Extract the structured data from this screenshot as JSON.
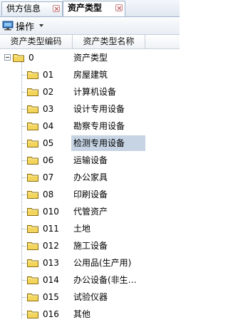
{
  "tabs": [
    {
      "label": "供方信息",
      "active": false
    },
    {
      "label": "资产类型",
      "active": true
    }
  ],
  "toolbar": {
    "operate_label": "操作"
  },
  "columns": {
    "code": "资产类型编码",
    "name": "资产类型名称"
  },
  "colors": {
    "selection": "#c6d4e4",
    "folder": "#f2d55a"
  },
  "tree": [
    {
      "code": "0",
      "name": "资产类型",
      "level": 0,
      "expanded": true,
      "selected": false
    },
    {
      "code": "01",
      "name": "房屋建筑",
      "level": 1,
      "selected": false
    },
    {
      "code": "02",
      "name": "计算机设备",
      "level": 1,
      "selected": false
    },
    {
      "code": "03",
      "name": "设计专用设备",
      "level": 1,
      "selected": false
    },
    {
      "code": "04",
      "name": "勘察专用设备",
      "level": 1,
      "selected": false
    },
    {
      "code": "05",
      "name": "检测专用设备",
      "level": 1,
      "selected": true
    },
    {
      "code": "06",
      "name": "运输设备",
      "level": 1,
      "selected": false
    },
    {
      "code": "07",
      "name": "办公家具",
      "level": 1,
      "selected": false
    },
    {
      "code": "08",
      "name": "印刷设备",
      "level": 1,
      "selected": false
    },
    {
      "code": "010",
      "name": "代管资产",
      "level": 1,
      "selected": false
    },
    {
      "code": "011",
      "name": "土地",
      "level": 1,
      "selected": false
    },
    {
      "code": "012",
      "name": "施工设备",
      "level": 1,
      "selected": false
    },
    {
      "code": "013",
      "name": "公用品(生产用)",
      "level": 1,
      "selected": false
    },
    {
      "code": "014",
      "name": "办公设备(非生…",
      "level": 1,
      "selected": false
    },
    {
      "code": "015",
      "name": "试验仪器",
      "level": 1,
      "selected": false
    },
    {
      "code": "016",
      "name": "其他",
      "level": 1,
      "selected": false
    }
  ]
}
